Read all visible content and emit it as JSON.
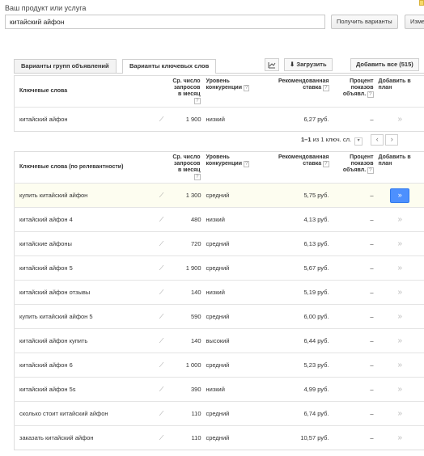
{
  "header": {
    "label": "Ваш продукт или услуга",
    "search_value": "китайский айфон",
    "get_button": "Получить варианты",
    "change_button": "Изме"
  },
  "tabs": [
    {
      "label": "Варианты групп объявлений",
      "active": false
    },
    {
      "label": "Варианты ключевых слов",
      "active": true
    }
  ],
  "toolbar": {
    "chart_icon": "chart-icon",
    "download_label": "Загрузить",
    "add_all_label": "Добавить все (515)"
  },
  "table1": {
    "headers": {
      "keywords": "Ключевые слова",
      "searches": "Ср. число запросов в месяц",
      "competition": "Уровень конкуренции",
      "bid": "Рекомендованная ставка",
      "share": "Процент показов объявл.",
      "add": "Добавить в план",
      "help": "?"
    },
    "rows": [
      {
        "kw": "китайский айфон",
        "searches": "1 900",
        "comp": "низкий",
        "bid": "6,27 руб.",
        "share": "–"
      }
    ]
  },
  "pager": {
    "range": "1–1",
    "rest": "из 1 ключ. сл.",
    "prev": "‹",
    "next": "›"
  },
  "table2": {
    "headers": {
      "keywords": "Ключевые слова (по релевантности)",
      "searches": "Ср. число запросов в месяц",
      "competition": "Уровень конкуренции",
      "bid": "Рекомендованная ставка",
      "share": "Процент показов объявл.",
      "add": "Добавить в план",
      "help": "?"
    },
    "rows": [
      {
        "kw": "купить китайский айфон",
        "searches": "1 300",
        "comp": "средний",
        "bid": "5,75 руб.",
        "share": "–"
      },
      {
        "kw": "китайский айфон 4",
        "searches": "480",
        "comp": "низкий",
        "bid": "4,13 руб.",
        "share": "–"
      },
      {
        "kw": "китайские айфоны",
        "searches": "720",
        "comp": "средний",
        "bid": "6,13 руб.",
        "share": "–"
      },
      {
        "kw": "китайский айфон 5",
        "searches": "1 900",
        "comp": "средний",
        "bid": "5,67 руб.",
        "share": "–"
      },
      {
        "kw": "китайский айфон отзывы",
        "searches": "140",
        "comp": "низкий",
        "bid": "5,19 руб.",
        "share": "–"
      },
      {
        "kw": "купить китайский айфон 5",
        "searches": "590",
        "comp": "средний",
        "bid": "6,00 руб.",
        "share": "–"
      },
      {
        "kw": "китайский айфон купить",
        "searches": "140",
        "comp": "высокий",
        "bid": "6,44 руб.",
        "share": "–"
      },
      {
        "kw": "китайский айфон 6",
        "searches": "1 000",
        "comp": "средний",
        "bid": "5,23 руб.",
        "share": "–"
      },
      {
        "kw": "китайский айфон 5s",
        "searches": "390",
        "comp": "низкий",
        "bid": "4,99 руб.",
        "share": "–"
      },
      {
        "kw": "сколько стоит китайский айфон",
        "searches": "110",
        "comp": "средний",
        "bid": "6,74 руб.",
        "share": "–"
      },
      {
        "kw": "заказать китайский айфон",
        "searches": "110",
        "comp": "средний",
        "bid": "10,57 руб.",
        "share": "–"
      }
    ]
  },
  "glyphs": {
    "trend": "⟋",
    "add": "»"
  }
}
